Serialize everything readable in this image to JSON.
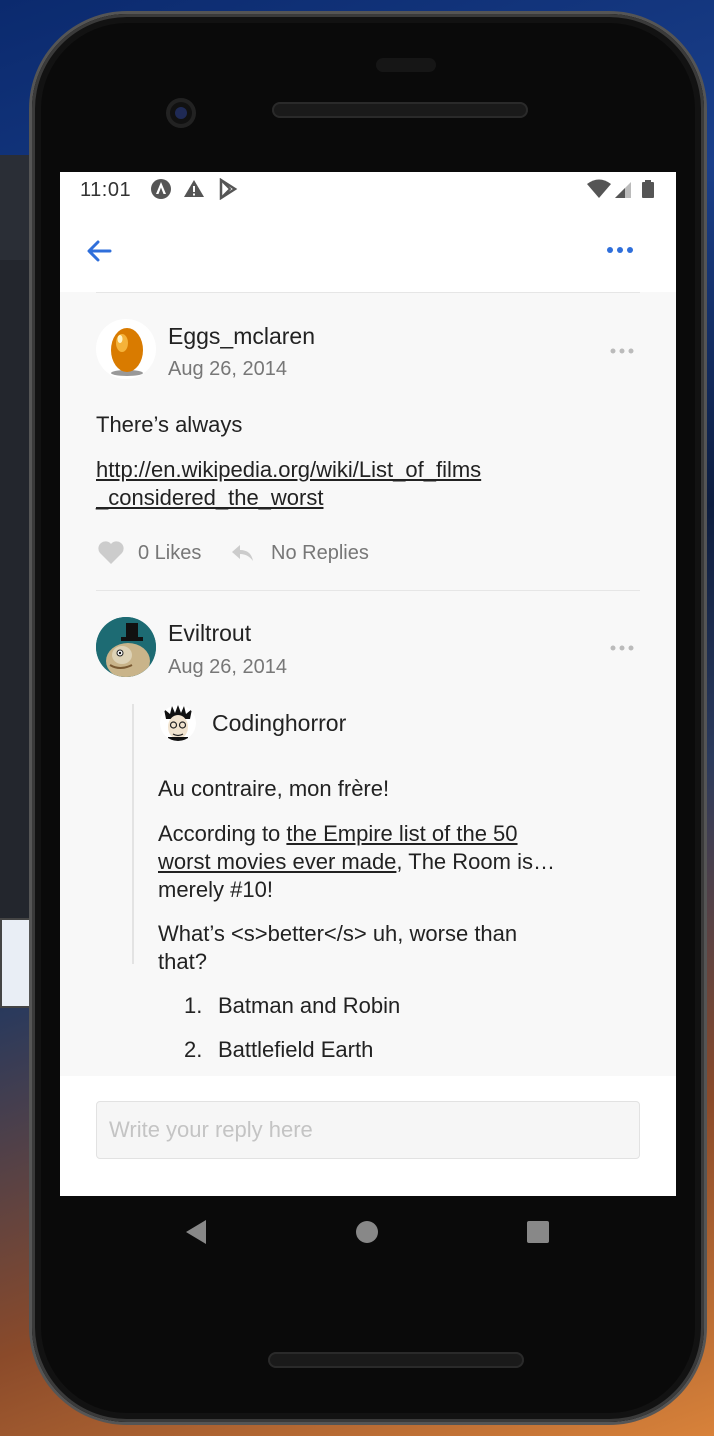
{
  "status_bar": {
    "time": "11:01",
    "icons": [
      "angular-icon",
      "warning-icon",
      "play-store-icon",
      "wifi-icon",
      "signal-icon",
      "battery-icon"
    ]
  },
  "header": {
    "back_icon": "arrow-left-icon",
    "more_icon": "more-horizontal-icon",
    "accent_color": "#2f6fdb"
  },
  "posts": [
    {
      "username": "Eggs_mclaren",
      "date": "Aug 26, 2014",
      "avatar": "golden-egg",
      "text": "There’s always",
      "link_line1": "http://en.wikipedia.org/wiki/List_of_films",
      "link_line2": "_considered_the_worst",
      "likes": "0 Likes",
      "replies": "No Replies"
    },
    {
      "username": "Eviltrout",
      "date": "Aug 26, 2014",
      "avatar": "trout-top-hat",
      "quote": {
        "username": "Codinghorror",
        "line1": "Au contraire, mon frère!",
        "para2_prefix": "According to ",
        "para2_link_a": "the Empire list of the 50",
        "para2_link_b": "worst movies ever made",
        "para2_suffix_a": ", The Room is…",
        "para2_suffix_b": "merely #10!",
        "para3_line1": "What’s <s>better</s> uh, worse than",
        "para3_line2": "that?",
        "list": [
          {
            "num": "1.",
            "text": "Batman and Robin"
          },
          {
            "num": "2.",
            "text": "Battlefield Earth"
          }
        ]
      }
    }
  ],
  "compose": {
    "placeholder": "Write your reply here"
  },
  "nav": {
    "back": "nav-back-icon",
    "home": "nav-home-icon",
    "recents": "nav-recents-icon"
  }
}
